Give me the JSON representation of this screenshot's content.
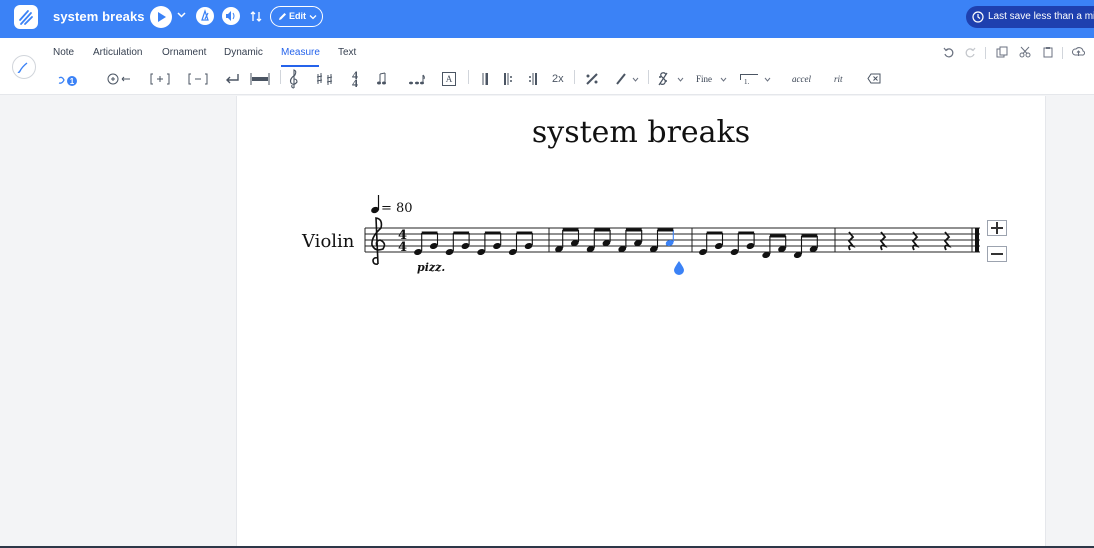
{
  "header": {
    "title": "system breaks",
    "edit_label": "Edit",
    "save_status": "Last save less than a min"
  },
  "toolbar": {
    "tabs": [
      "Note",
      "Articulation",
      "Ornament",
      "Dynamic",
      "Measure",
      "Text"
    ],
    "active_tab": "Measure",
    "voice_badge": "1",
    "repeat_label": "2x",
    "fine_label": "Fine",
    "ending_label": "1.",
    "accel_label": "accel",
    "rit_label": "rit",
    "text_box_label": "A"
  },
  "score": {
    "title": "system breaks",
    "instrument": "Violin",
    "tempo": "= 80",
    "expression": "pizz.",
    "time_signature": [
      "4",
      "4"
    ],
    "measures": [
      {
        "notes": [
          "E4",
          "G4",
          "E4",
          "G4",
          "E4",
          "G4",
          "E4",
          "G4"
        ]
      },
      {
        "notes": [
          "F4",
          "A4",
          "F4",
          "A4",
          "F4",
          "A4",
          "F4",
          "A4"
        ],
        "selected_index": 7
      },
      {
        "notes": [
          "E4",
          "G4",
          "E4",
          "G4",
          "D4",
          "F4",
          "D4",
          "F4"
        ]
      },
      {
        "rests": 4
      }
    ]
  },
  "colors": {
    "brand": "#3b82f6",
    "brand_dark": "#1e40af",
    "accent": "#2563eb",
    "selected_note": "#3b82f6"
  }
}
